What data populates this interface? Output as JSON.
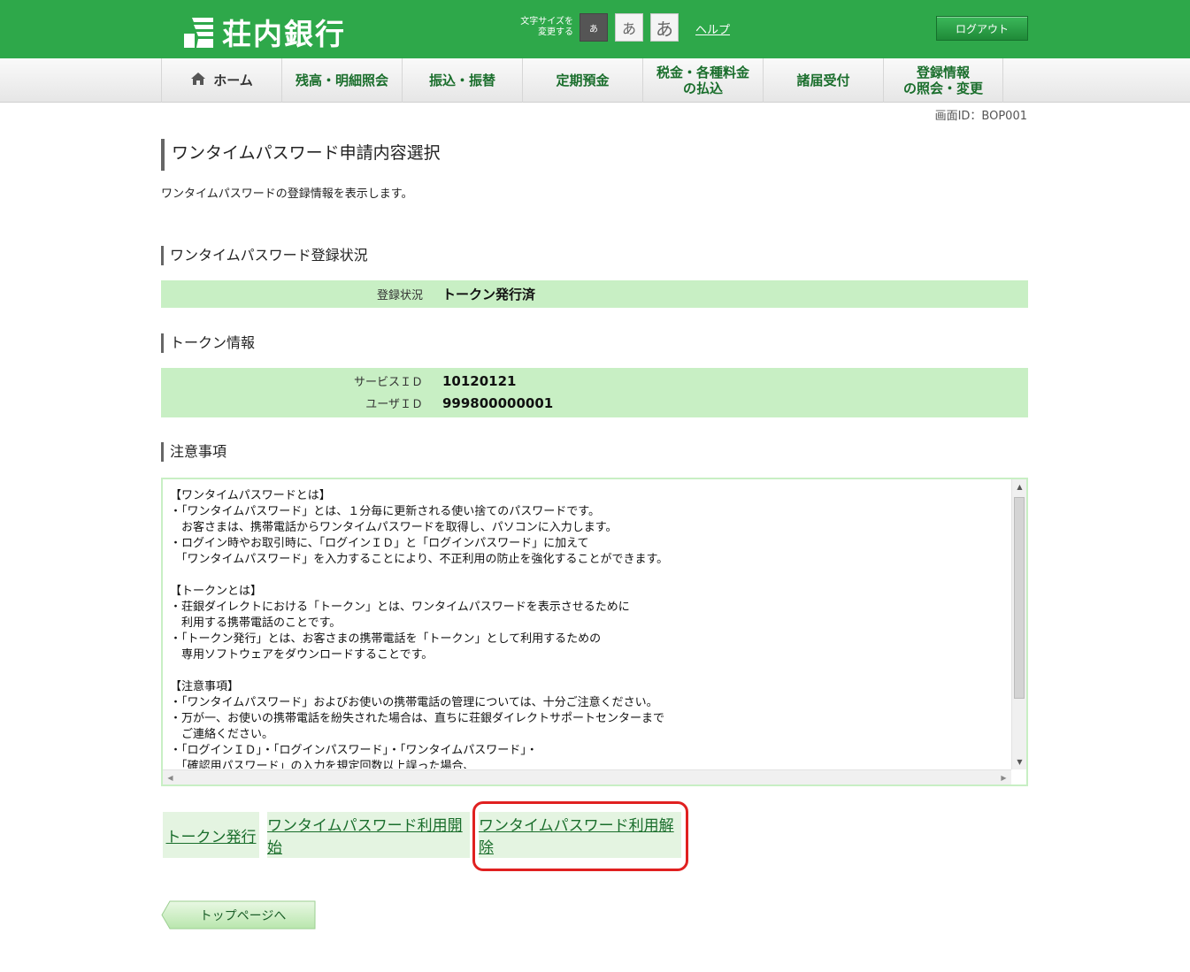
{
  "header": {
    "bank_name": "荘内銀行",
    "font_size_label_1": "文字サイズを",
    "font_size_label_2": "変更する",
    "font_sizes": [
      "あ",
      "あ",
      "あ"
    ],
    "help": "ヘルプ",
    "logout": "ログアウト",
    "brand_color": "#2ea84a"
  },
  "nav": {
    "home": "ホーム",
    "items": [
      {
        "line1": "残高・明細照会",
        "line2": ""
      },
      {
        "line1": "振込・振替",
        "line2": ""
      },
      {
        "line1": "定期預金",
        "line2": ""
      },
      {
        "line1": "税金・各種料金",
        "line2": "の払込"
      },
      {
        "line1": "諸届受付",
        "line2": ""
      },
      {
        "line1": "登録情報",
        "line2": "の照会・変更"
      }
    ]
  },
  "screen_id": "画面ID：BOP001",
  "page": {
    "title": "ワンタイムパスワード申請内容選択",
    "description": "ワンタイムパスワードの登録情報を表示します。"
  },
  "status_section": {
    "title": "ワンタイムパスワード登録状況",
    "label": "登録状況",
    "value": "トークン発行済"
  },
  "token_section": {
    "title": "トークン情報",
    "service_id_label": "サービスＩＤ",
    "service_id": "10120121",
    "user_id_label": "ユーザＩＤ",
    "user_id": "999800000001"
  },
  "notice_section": {
    "title": "注意事項",
    "text": "【ワンタイムパスワードとは】\n・「ワンタイムパスワード」とは、１分毎に更新される使い捨てのパスワードです。\n　お客さまは、携帯電話からワンタイムパスワードを取得し、パソコンに入力します。\n・ログイン時やお取引時に、「ログインＩＤ」と「ログインパスワード」に加えて\n　「ワンタイムパスワード」を入力することにより、不正利用の防止を強化することができます。\n\n【トークンとは】\n・荘銀ダイレクトにおける「トークン」とは、ワンタイムパスワードを表示させるために\n　利用する携帯電話のことです。\n・「トークン発行」とは、お客さまの携帯電話を「トークン」として利用するための\n　専用ソフトウェアをダウンロードすることです。\n\n【注意事項】\n・「ワンタイムパスワード」およびお使いの携帯電話の管理については、十分ご注意ください。\n・万が一、お使いの携帯電話を紛失された場合は、直ちに荘銀ダイレクトサポートセンターまで\n　ご連絡ください。\n・「ログインＩＤ」・「ログインパスワード」・「ワンタイムパスワード」・\n　「確認用パスワード」の入力を規定回数以上誤った場合、"
  },
  "actions": {
    "issue_token": "トークン発行",
    "start_otp": "ワンタイムパスワード利用開始",
    "cancel_otp": "ワンタイムパスワード利用解除"
  },
  "top_page": "トップページへ"
}
